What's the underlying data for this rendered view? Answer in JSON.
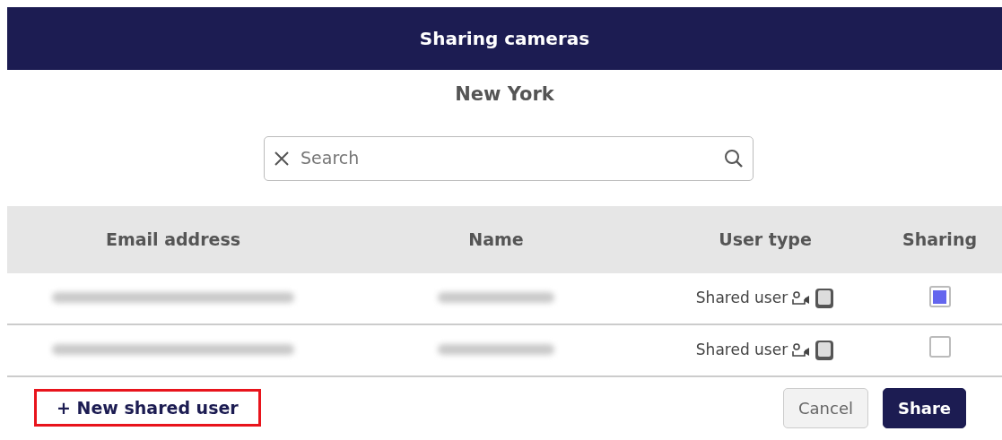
{
  "window": {
    "title": "Sharing cameras"
  },
  "location": "New York",
  "search": {
    "placeholder": "Search"
  },
  "table": {
    "columns": [
      "Email address",
      "Name",
      "User type",
      "Sharing"
    ],
    "rows": [
      {
        "email_redacted": true,
        "name_redacted": true,
        "user_type": "Shared user",
        "sharing": true
      },
      {
        "email_redacted": true,
        "name_redacted": true,
        "user_type": "Shared user",
        "sharing": false
      }
    ]
  },
  "new_user_link": {
    "label": "+ New shared user",
    "highlighted": true
  },
  "buttons": [
    {
      "label": "Cancel",
      "kind": "secondary"
    },
    {
      "label": "Share",
      "kind": "primary"
    }
  ]
}
